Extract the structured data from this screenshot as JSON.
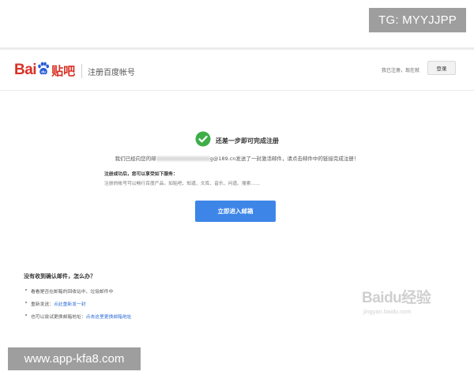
{
  "overlays": {
    "tg_badge": "TG: MYYJJPP",
    "app_badge": "www.app-kfa8.com"
  },
  "header": {
    "logo_bai": "Bai",
    "logo_tieba": "贴吧",
    "page_title": "注册百度帐号",
    "login_hint": "我已注册，现在就",
    "login_button": "登录"
  },
  "main": {
    "success_title": "还差一步即可完成注册",
    "sent_prefix": "我们已经向您的邮",
    "sent_suffix": "g@189.cn发送了一封激活邮件，请点击邮件中的链接完成注册！",
    "features_title": "注册成功后，您可以享受如下服务：",
    "features_line": "注册的帐号可以畅行百度产品，如贴吧、知道、文库、音乐、问道、搜索……",
    "enter_button": "立即进入邮箱"
  },
  "help": {
    "title": "没有收到确认邮件，怎么办？",
    "items": [
      {
        "text": "看看是否在邮箱的回收站中、垃圾邮件中",
        "link": ""
      },
      {
        "text": "重新发送：",
        "link": "点此重新发一封"
      },
      {
        "text": "也可以尝试更换邮箱地址：",
        "link": "点击这里更换邮箱地址"
      }
    ]
  },
  "watermark": {
    "text": "Baidu经验",
    "sub": "jingyan.baidu.com"
  },
  "colors": {
    "brand_red": "#d93025",
    "button_blue": "#3d86e8",
    "success_green": "#3fae49",
    "link_blue": "#2d6bd6"
  }
}
